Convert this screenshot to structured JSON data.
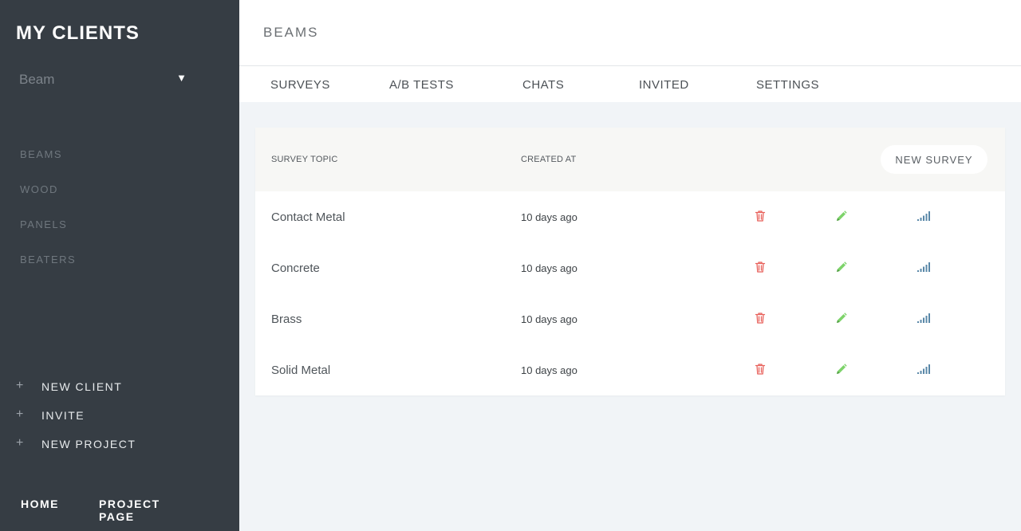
{
  "sidebar": {
    "title": "MY CLIENTS",
    "client_select": {
      "value": "Beam",
      "caret": "▼"
    },
    "projects": [
      "BEAMS",
      "WOOD",
      "PANELS",
      "BEATERS"
    ],
    "actions": [
      {
        "icon": "plus-icon",
        "label": "NEW CLIENT"
      },
      {
        "icon": "plus-icon",
        "label": "INVITE"
      },
      {
        "icon": "plus-icon",
        "label": "NEW PROJECT"
      }
    ],
    "bottom_links": [
      "HOME",
      "PROJECT PAGE"
    ]
  },
  "header": {
    "title": "BEAMS"
  },
  "tabs": [
    "SURVEYS",
    "A/B TESTS",
    "CHATS",
    "INVITED",
    "SETTINGS"
  ],
  "table": {
    "columns": {
      "topic": "SURVEY TOPIC",
      "created": "CREATED AT"
    },
    "new_button": "NEW SURVEY",
    "rows": [
      {
        "topic": "Contact Metal",
        "created": "10 days ago"
      },
      {
        "topic": "Concrete",
        "created": "10 days ago"
      },
      {
        "topic": "Brass",
        "created": "10 days ago"
      },
      {
        "topic": "Solid Metal",
        "created": "10 days ago"
      }
    ]
  },
  "colors": {
    "sidebar_bg": "#363d44",
    "delete_icon": "#e8625c",
    "edit_icon": "#7dd36a",
    "stats_icon": "#5a88a8"
  }
}
